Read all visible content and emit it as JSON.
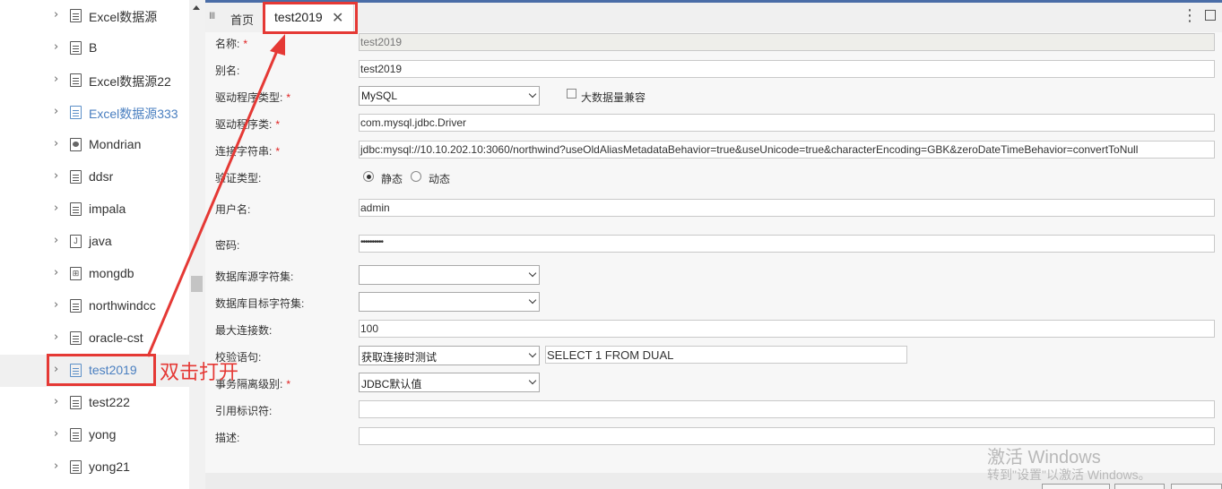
{
  "sidebar": {
    "items": [
      {
        "label": "Excel数据源",
        "icon": "datasource-icon"
      },
      {
        "label": "B",
        "icon": "datasource-icon"
      },
      {
        "label": "Excel数据源22",
        "icon": "datasource-icon"
      },
      {
        "label": "Excel数据源333",
        "icon": "datasource-icon"
      },
      {
        "label": "Mondrian",
        "icon": "mondrian-icon"
      },
      {
        "label": "ddsr",
        "icon": "datasource-icon"
      },
      {
        "label": "impala",
        "icon": "datasource-icon"
      },
      {
        "label": "java",
        "icon": "java-icon"
      },
      {
        "label": "mongdb",
        "icon": "mongodb-icon"
      },
      {
        "label": "northwindcc",
        "icon": "datasource-icon"
      },
      {
        "label": "oracle-cst",
        "icon": "datasource-icon"
      },
      {
        "label": "test2019",
        "icon": "datasource-icon"
      },
      {
        "label": "test222",
        "icon": "datasource-icon"
      },
      {
        "label": "yong",
        "icon": "datasource-icon"
      },
      {
        "label": "yong21",
        "icon": "datasource-icon"
      }
    ],
    "selected": "test2019"
  },
  "tabs": {
    "grip": "III",
    "home": "首页",
    "active": "test2019",
    "close": "✕"
  },
  "form": {
    "name": {
      "label": "名称:",
      "required": "*",
      "value": "test2019"
    },
    "alias": {
      "label": "别名:",
      "value": "test2019"
    },
    "driver_type": {
      "label": "驱动程序类型:",
      "required": "*",
      "value": "MySQL"
    },
    "big_data": {
      "label": "大数据量兼容",
      "checked": false
    },
    "driver_class": {
      "label": "驱动程序类:",
      "required": "*",
      "value": "com.mysql.jdbc.Driver"
    },
    "conn_string": {
      "label": "连接字符串:",
      "required": "*",
      "value": "jdbc:mysql://10.10.202.10:3060/northwind?useOldAliasMetadataBehavior=true&useUnicode=true&characterEncoding=GBK&zeroDateTimeBehavior=convertToNull"
    },
    "auth_type": {
      "label": "验证类型:",
      "options": [
        "静态",
        "动态"
      ],
      "selected": "静态"
    },
    "username": {
      "label": "用户名:",
      "value": "admin"
    },
    "password": {
      "label": "密码:",
      "value": "••••••••••"
    },
    "src_charset": {
      "label": "数据库源字符集:",
      "value": ""
    },
    "dst_charset": {
      "label": "数据库目标字符集:",
      "value": ""
    },
    "max_conn": {
      "label": "最大连接数:",
      "value": "100"
    },
    "validation": {
      "label": "校验语句:",
      "value": "获取连接时测试",
      "sql": "SELECT 1 FROM DUAL"
    },
    "isolation": {
      "label": "事务隔离级别:",
      "required": "*",
      "value": "JDBC默认值"
    },
    "quote": {
      "label": "引用标识符:",
      "value": ""
    },
    "desc": {
      "label": "描述:",
      "value": ""
    }
  },
  "annotation": {
    "text": "双击打开",
    "color": "#e53935"
  },
  "watermark": {
    "line1": "激活 Windows",
    "line2": "转到\"设置\"以激活 Windows。"
  }
}
